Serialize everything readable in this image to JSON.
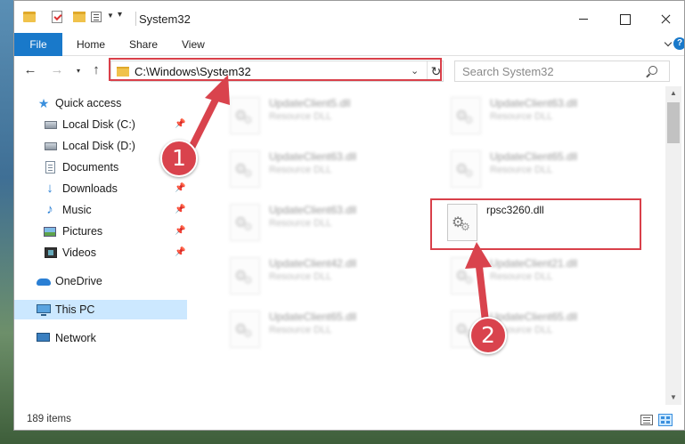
{
  "window": {
    "title": "System32",
    "controls": {
      "minimize": "",
      "maximize": "",
      "close": ""
    }
  },
  "ribbon": {
    "tabs": [
      "File",
      "Home",
      "Share",
      "View"
    ],
    "help": "?"
  },
  "navigation": {
    "back": "←",
    "forward": "→",
    "recent": "▾",
    "up": "↑",
    "address": "C:\\Windows\\System32",
    "address_dropdown": "⌄",
    "refresh": "↻",
    "search_placeholder": "Search System32"
  },
  "sidebar": {
    "items": [
      {
        "label": "Quick access",
        "icon": "star-icon",
        "pinned": false
      },
      {
        "label": "Local Disk (C:)",
        "icon": "drive-icon",
        "pinned": true
      },
      {
        "label": "Local Disk (D:)",
        "icon": "drive-icon",
        "pinned": false
      },
      {
        "label": "Documents",
        "icon": "documents-icon",
        "pinned": true
      },
      {
        "label": "Downloads",
        "icon": "download-icon",
        "pinned": true
      },
      {
        "label": "Music",
        "icon": "music-icon",
        "pinned": true
      },
      {
        "label": "Pictures",
        "icon": "pictures-icon",
        "pinned": true
      },
      {
        "label": "Videos",
        "icon": "videos-icon",
        "pinned": true
      },
      {
        "label": "OneDrive",
        "icon": "cloud-icon",
        "pinned": false
      },
      {
        "label": "This PC",
        "icon": "computer-icon",
        "pinned": false,
        "selected": true
      },
      {
        "label": "Network",
        "icon": "network-icon",
        "pinned": false
      }
    ],
    "pin_glyph": "📌"
  },
  "files": [
    {
      "name": "UpdateClient5.dll",
      "type": "Resource DLL",
      "blurred": true
    },
    {
      "name": "UpdateClient63.dll",
      "type": "Resource DLL",
      "blurred": true
    },
    {
      "name": "UpdateClient63.dll",
      "type": "Resource DLL",
      "blurred": true
    },
    {
      "name": "UpdateClient65.dll",
      "type": "Resource DLL",
      "blurred": true
    },
    {
      "name": "UpdateClient63.dll",
      "type": "Resource DLL",
      "blurred": true
    },
    {
      "name": "rpsc3260.dll",
      "type": "",
      "blurred": false,
      "highlighted": true
    },
    {
      "name": "UpdateClient42.dll",
      "type": "Resource DLL",
      "blurred": true
    },
    {
      "name": "UpdateClient21.dll",
      "type": "Resource DLL",
      "blurred": true
    },
    {
      "name": "UpdateClient65.dll",
      "type": "Resource DLL",
      "blurred": true
    },
    {
      "name": "UpdateClient65.dll",
      "type": "Resource DLL",
      "blurred": true
    }
  ],
  "status": {
    "item_count": "189 items"
  },
  "annotations": {
    "step1": "1",
    "step2": "2",
    "color": "#d9404a"
  },
  "colors": {
    "accent": "#1979ca",
    "selection": "#cce8ff"
  }
}
